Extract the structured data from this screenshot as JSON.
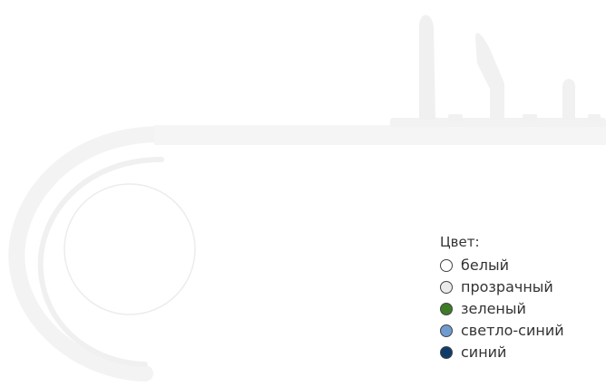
{
  "color_selector": {
    "title": "Цвет:",
    "options": [
      {
        "label": "белый",
        "swatch": "#ffffff"
      },
      {
        "label": "прозрачный",
        "swatch": "#ebebeb"
      },
      {
        "label": "зеленый",
        "swatch": "#3e7b27"
      },
      {
        "label": "светло-синий",
        "swatch": "#6f9bd1"
      },
      {
        "label": "синий",
        "swatch": "#0f3d6b"
      }
    ]
  },
  "colors": {
    "decor_light": "#f3f3f3",
    "decor_mid": "#f0f0f0",
    "decor_line": "#ececec",
    "text": "#333333",
    "swatch_border": "#444444"
  }
}
